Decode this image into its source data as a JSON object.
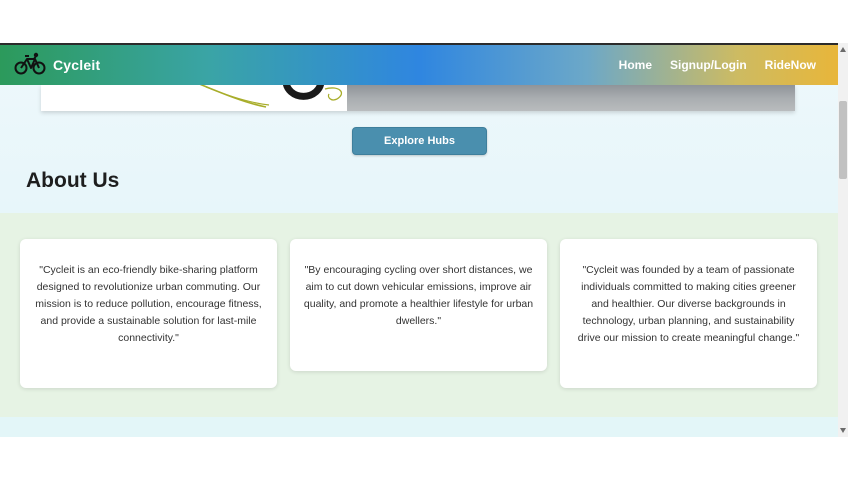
{
  "navbar": {
    "brand": "Cycleit",
    "links": [
      "Home",
      "Signup/Login",
      "RideNow"
    ]
  },
  "hero": {
    "explore_label": "Explore Hubs"
  },
  "about": {
    "title": "About Us",
    "cards": [
      "\"Cycleit is an eco-friendly bike-sharing platform designed to revolutionize urban commuting. Our mission is to reduce pollution, encourage fitness, and provide a sustainable solution for last-mile connectivity.\"",
      "\"By encouraging cycling over short distances, we aim to cut down vehicular emissions, improve air quality, and promote a healthier lifestyle for urban dwellers.\"",
      "\"Cycleit was founded by a team of passionate individuals committed to making cities greener and healthier. Our diverse backgrounds in technology, urban planning, and sustainability drive our mission to create meaningful change.\""
    ]
  },
  "colors": {
    "navbar_gradient": [
      "#2c9a5b",
      "#2f86e0",
      "#e8b63a"
    ],
    "button": "#4a8fae",
    "about_band": "#e6f3e4"
  },
  "icons": {
    "brand": "bicycle-icon"
  }
}
